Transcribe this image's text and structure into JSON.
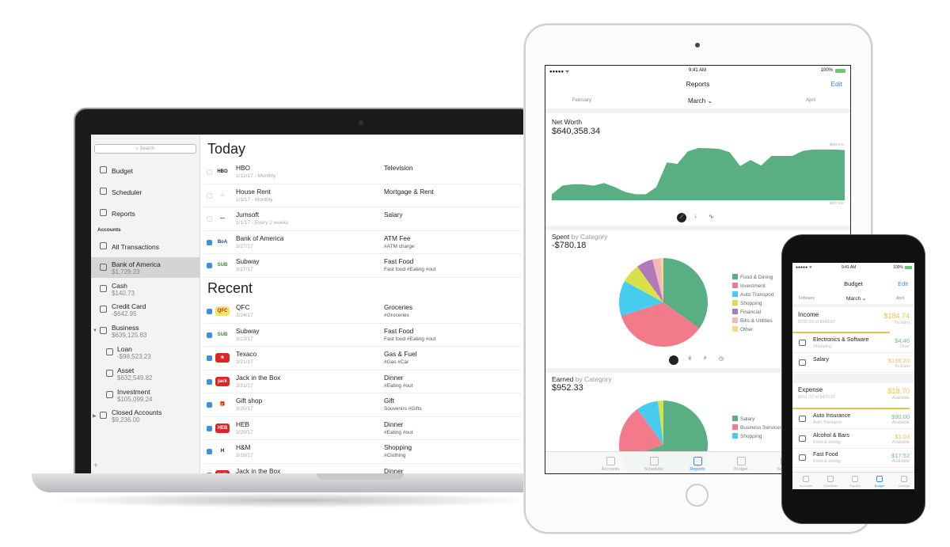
{
  "laptop": {
    "search_placeholder": "Search",
    "nav": [
      {
        "label": "Budget",
        "icon": "budget-icon"
      },
      {
        "label": "Scheduler",
        "icon": "calendar-icon"
      },
      {
        "label": "Reports",
        "icon": "bar-chart-icon"
      }
    ],
    "accounts_header": "Accounts",
    "accounts": [
      {
        "label": "All Transactions",
        "amount": null
      },
      {
        "label": "Bank of America",
        "amount": "$1,729.23",
        "selected": true
      },
      {
        "label": "Cash",
        "amount": "$140.73"
      },
      {
        "label": "Credit Card",
        "amount": "-$642.95"
      },
      {
        "label": "Business",
        "amount": "$639,125.83",
        "expanded": true
      },
      {
        "label": "Loan",
        "amount": "-$98,523.23"
      },
      {
        "label": "Asset",
        "amount": "$632,549.82"
      },
      {
        "label": "Investment",
        "amount": "$105,099.24"
      },
      {
        "label": "Closed Accounts",
        "amount": "$9,236.00",
        "expanded": false
      }
    ],
    "add_label": "+",
    "today_title": "Today",
    "today": [
      {
        "name": "HBO",
        "date": "1/12/17 -  Monthly",
        "category": "Television",
        "tags": "",
        "logo": "HBO",
        "checked": false
      },
      {
        "name": "House Rent",
        "date": "1/3/17 -  Monthly",
        "category": "Mortgage & Rent",
        "tags": "",
        "logo": "⌂",
        "checked": false
      },
      {
        "name": "Jumsoft",
        "date": "1/1/17 -  Every 2 weeks",
        "category": "Salary",
        "tags": "",
        "logo": "—",
        "checked": false
      },
      {
        "name": "Bank of America",
        "date": "3/27/17",
        "category": "ATM Fee",
        "tags": "#ATM charge",
        "logo": "BoA",
        "checked": true
      },
      {
        "name": "Subway",
        "date": "3/27/17",
        "category": "Fast Food",
        "tags": "Fast food #Eating #out",
        "logo": "SUB",
        "checked": true
      }
    ],
    "recent_title": "Recent",
    "recent": [
      {
        "name": "QFC",
        "date": "3/24/17",
        "category": "Groceries",
        "tags": "#Groceries",
        "logo": "QFC",
        "checked": true
      },
      {
        "name": "Subway",
        "date": "3/23/17",
        "category": "Fast Food",
        "tags": "Fast food #Eating #out",
        "logo": "SUB",
        "checked": true
      },
      {
        "name": "Texaco",
        "date": "3/21/17",
        "category": "Gas & Fuel",
        "tags": "#Gas #Car",
        "logo": "★",
        "checked": true
      },
      {
        "name": "Jack in the Box",
        "date": "3/21/17",
        "category": "Dinner",
        "tags": "#Eating #out",
        "logo": "jack",
        "checked": true
      },
      {
        "name": "Gift shop",
        "date": "3/20/17",
        "category": "Gift",
        "tags": "Souvenirs #Gifts",
        "logo": "🎁",
        "checked": true
      },
      {
        "name": "HEB",
        "date": "3/20/17",
        "category": "Dinner",
        "tags": "#Eating #out",
        "logo": "HEB",
        "checked": true
      },
      {
        "name": "H&M",
        "date": "3/19/17",
        "category": "Shopping",
        "tags": "#Clothing",
        "logo": "H",
        "checked": true
      },
      {
        "name": "Jack in the Box",
        "date": "",
        "category": "Dinner",
        "tags": "",
        "logo": "jack",
        "checked": true
      }
    ]
  },
  "ipad": {
    "status": {
      "left": "●●●●● ᯤ",
      "time": "9:41 AM",
      "right": "100%"
    },
    "title": "Reports",
    "edit": "Edit",
    "months": {
      "prev": "February",
      "current": "March ⌄",
      "next": "April"
    },
    "net_worth": {
      "label": "Net Worth",
      "value": "$640,358.34",
      "max_label": "$640.6 K",
      "min_label": "$637.3 K",
      "color": "#5aaf82",
      "series_k": [
        637.65,
        638.17,
        638.25,
        638.25,
        638.17,
        638.33,
        638.09,
        637.8,
        637.66,
        637.66,
        638.09,
        639.55,
        639.47,
        640.21,
        640.41,
        640.4,
        640.36,
        640.16,
        639.34,
        639.7,
        639.37,
        639.94,
        639.94,
        639.94,
        640.24,
        640.32,
        640.32,
        640.32,
        640.29
      ],
      "ylim": [
        637.3,
        640.6
      ]
    },
    "spent": {
      "label": "Spent",
      "by": "by Category",
      "value": "-$780.18",
      "slices": [
        {
          "name": "Food & Dining",
          "pct": 35,
          "color": "#5aaf82"
        },
        {
          "name": "Investment",
          "pct": 35,
          "color": "#f27a8a"
        },
        {
          "name": "Auto Transport",
          "pct": 13,
          "color": "#47ccf0"
        },
        {
          "name": "Shopping",
          "pct": 7,
          "color": "#d8e04b"
        },
        {
          "name": "Financial",
          "pct": 6,
          "color": "#b07ab8"
        },
        {
          "name": "Bills & Utilities",
          "pct": 3,
          "color": "#f5b8b8"
        },
        {
          "name": "Other",
          "pct": 1,
          "color": "#f7d88a"
        }
      ]
    },
    "earned": {
      "label": "Earned",
      "by": "by Category",
      "value": "$952.33",
      "slices": [
        {
          "name": "Salary",
          "pct": 70,
          "color": "#5aaf82"
        },
        {
          "name": "Business Services",
          "pct": 20,
          "color": "#f27a8a"
        },
        {
          "name": "Shopping",
          "pct": 8,
          "color": "#47ccf0"
        },
        {
          "name": "",
          "pct": 2,
          "color": "#d8e04b"
        }
      ]
    },
    "tabs": [
      "Accounts",
      "Scheduler",
      "Reports",
      "Budget",
      "Settings"
    ],
    "active_tab": "Reports",
    "accent": "#3a8ee6"
  },
  "iphone": {
    "time": "9:41 AM",
    "battery": "100%",
    "title": "Budget",
    "edit": "Edit",
    "months": {
      "prev": "February",
      "current": "March ⌄",
      "next": "April"
    },
    "income": {
      "label": "Income",
      "sub": "$760.93 of $945.67",
      "value": "$184.74",
      "note": "To Earn",
      "progress": 0.8
    },
    "income_items": [
      {
        "name": "Electronics & Software",
        "cat": "Shopping",
        "value": "$4.46",
        "note": "Over",
        "color": "#6cc07f"
      },
      {
        "name": "Salary",
        "cat": "",
        "value": "$189.20",
        "note": "To Earn",
        "color": "#e8c444"
      }
    ],
    "expense": {
      "label": "Expense",
      "sub": "$451.37 of $470.07",
      "value": "$18.70",
      "note": "Available",
      "progress": 0.96
    },
    "expense_items": [
      {
        "name": "Auto Insurance",
        "cat": "Auto Transport",
        "value": "$90.00",
        "note": "Available",
        "color": "#6cc07f"
      },
      {
        "name": "Alcohol & Bars",
        "cat": "Food & Dining",
        "value": "$1.03",
        "note": "Available",
        "color": "#e8c444"
      },
      {
        "name": "Fast Food",
        "cat": "Food & Dining",
        "value": "$17.52",
        "note": "Available",
        "color": "#6cc07f"
      }
    ],
    "tabs": [
      "Accounts",
      "Scheduler",
      "Reports",
      "Budget",
      "Settings"
    ],
    "active_tab": "Budget"
  }
}
